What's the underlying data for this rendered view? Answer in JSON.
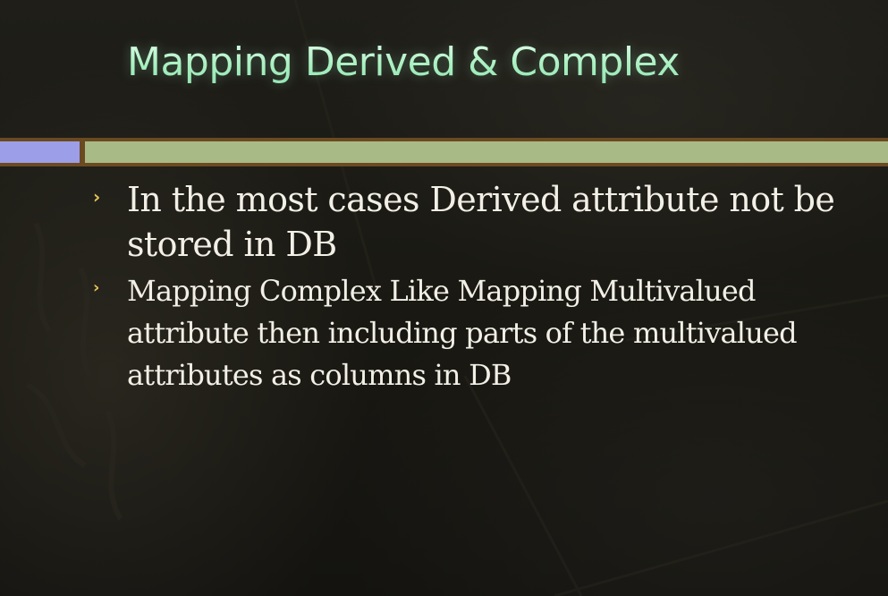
{
  "slide": {
    "title": "Mapping Derived & Complex",
    "bullets": [
      {
        "marker": "›",
        "text": "In the most cases Derived attribute not be stored in DB"
      },
      {
        "marker": "›",
        "text": "Mapping Complex Like Mapping Multivalued attribute then including parts of the multivalued attributes as columns in DB"
      }
    ]
  },
  "colors": {
    "title": "#a8f0c0",
    "bullet_marker": "#e3c25a",
    "body_text": "#f2efe6",
    "bar_blue": "#9c9ee8",
    "bar_green": "#a8ba86",
    "bar_frame": "#6b4a22",
    "background": "#1c1b16"
  }
}
